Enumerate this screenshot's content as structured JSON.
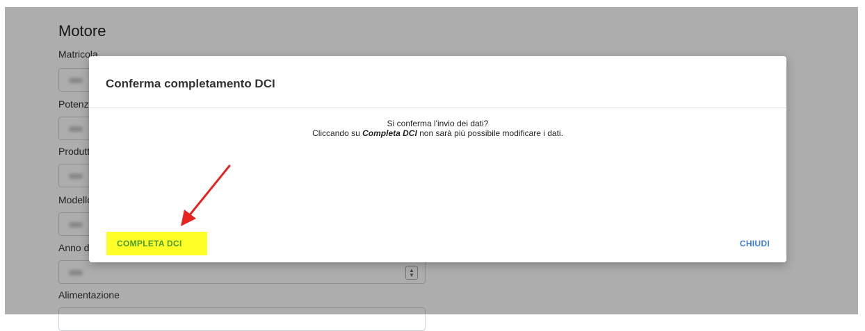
{
  "form": {
    "section_title": "Motore",
    "labels": {
      "matricola": "Matricola",
      "potenza": "Potenza",
      "produttore": "Produttore",
      "modello": "Modello",
      "anno": "Anno di costruzione",
      "alimentazione": "Alimentazione"
    }
  },
  "modal": {
    "title": "Conferma completamento DCI",
    "line1": "Si conferma l'invio dei dati?",
    "line2_prefix": "Cliccando su ",
    "line2_emphasis": "Completa DCI",
    "line2_suffix": " non sarà più possibile modificare i dati.",
    "confirm_label": "COMPLETA DCI",
    "close_label": "CHIUDI"
  },
  "colors": {
    "highlight": "#ffff27",
    "confirm_text": "#4a9a2a",
    "close_text": "#3f7fd6",
    "annotation_arrow": "#e52421"
  },
  "icons": {
    "annotation": "red-arrow-icon",
    "spinner": "number-spinner-icon"
  }
}
